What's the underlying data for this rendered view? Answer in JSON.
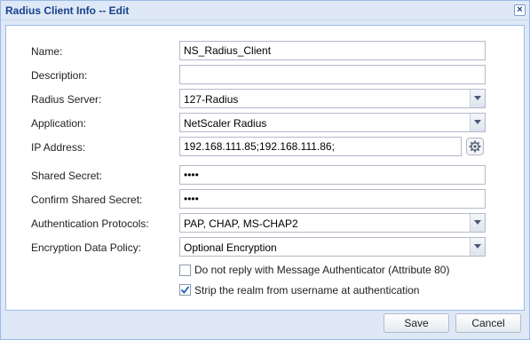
{
  "window": {
    "title": "Radius Client Info -- Edit",
    "close_glyph": "×"
  },
  "form": {
    "name": {
      "label": "Name:",
      "value": "NS_Radius_Client"
    },
    "description": {
      "label": "Description:",
      "value": ""
    },
    "radius_server": {
      "label": "Radius Server:",
      "value": "127-Radius"
    },
    "application": {
      "label": "Application:",
      "value": "NetScaler Radius"
    },
    "ip_address": {
      "label": "IP Address:",
      "value": "192.168.111.85;192.168.111.86;"
    },
    "shared_secret": {
      "label": "Shared Secret:",
      "value": "••••"
    },
    "confirm_shared_secret": {
      "label": "Confirm Shared Secret:",
      "value": "••••"
    },
    "auth_protocols": {
      "label": "Authentication Protocols:",
      "value": "PAP, CHAP, MS-CHAP2"
    },
    "encryption_policy": {
      "label": "Encryption Data Policy:",
      "value": "Optional Encryption"
    },
    "no_reply_msg_auth": {
      "label": "Do not reply with Message Authenticator (Attribute 80)",
      "checked": false
    },
    "strip_realm": {
      "label": "Strip the realm from username at authentication",
      "checked": true
    }
  },
  "buttons": {
    "save": "Save",
    "cancel": "Cancel"
  },
  "icons": {
    "dropdown": "chevron-down-icon",
    "settings": "gear-icon",
    "close": "close-icon"
  },
  "colors": {
    "title": "#15428b",
    "frame": "#dfe8f6",
    "border": "#99bbe8"
  }
}
